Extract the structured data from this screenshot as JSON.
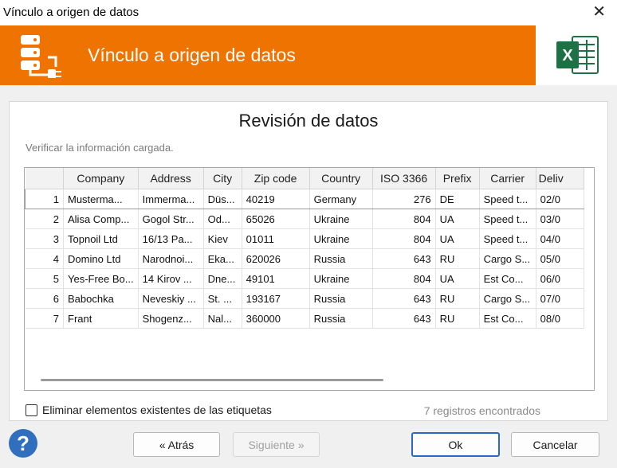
{
  "window": {
    "title": "Vínculo a origen de datos",
    "close": "✕"
  },
  "banner": {
    "title": "Vínculo a origen de datos",
    "excel_letter": "X"
  },
  "panel": {
    "title": "Revisión de datos",
    "subtitle": "Verificar la información cargada."
  },
  "table": {
    "columns": [
      "Company",
      "Address",
      "City",
      "Zip code",
      "Country",
      "ISO 3366",
      "Prefix",
      "Carrier",
      "Deliv"
    ],
    "rows": [
      [
        "1",
        "Musterma...",
        "Immerma...",
        "Düs...",
        "40219",
        "Germany",
        "276",
        "DE",
        "Speed t...",
        "02/0"
      ],
      [
        "2",
        "Alisa Comp...",
        "Gogol Str...",
        "Od...",
        "65026",
        "Ukraine",
        "804",
        "UA",
        "Speed t...",
        "03/0"
      ],
      [
        "3",
        "Topnoil Ltd",
        "16/13 Pa...",
        "Kiev",
        "01011",
        "Ukraine",
        "804",
        "UA",
        "Speed t...",
        "04/0"
      ],
      [
        "4",
        "Domino Ltd",
        "Narodnoi...",
        "Eka...",
        "620026",
        "Russia",
        "643",
        "RU",
        "Cargo S...",
        "05/0"
      ],
      [
        "5",
        "Yes-Free Bo...",
        "14 Kirov ...",
        "Dne...",
        "49101",
        "Ukraine",
        "804",
        "UA",
        "Est Co...",
        "06/0"
      ],
      [
        "6",
        "Babochka",
        "Neveskiy ...",
        "St. ...",
        "193167",
        "Russia",
        "643",
        "RU",
        "Cargo S...",
        "07/0"
      ],
      [
        "7",
        "Frant",
        "Shogenz...",
        "Nal...",
        "360000",
        "Russia",
        "643",
        "RU",
        "Est Co...",
        "08/0"
      ]
    ]
  },
  "footer": {
    "checkbox_label": "Eliminar elementos existentes de las etiquetas",
    "record_count": "7 registros encontrados",
    "help": "?",
    "back": "« Atrás",
    "next": "Siguiente »",
    "ok": "Ok",
    "cancel": "Cancelar"
  },
  "colors": {
    "accent": "#ef7300",
    "excel": "#1e7145",
    "help": "#2f6fbe"
  }
}
